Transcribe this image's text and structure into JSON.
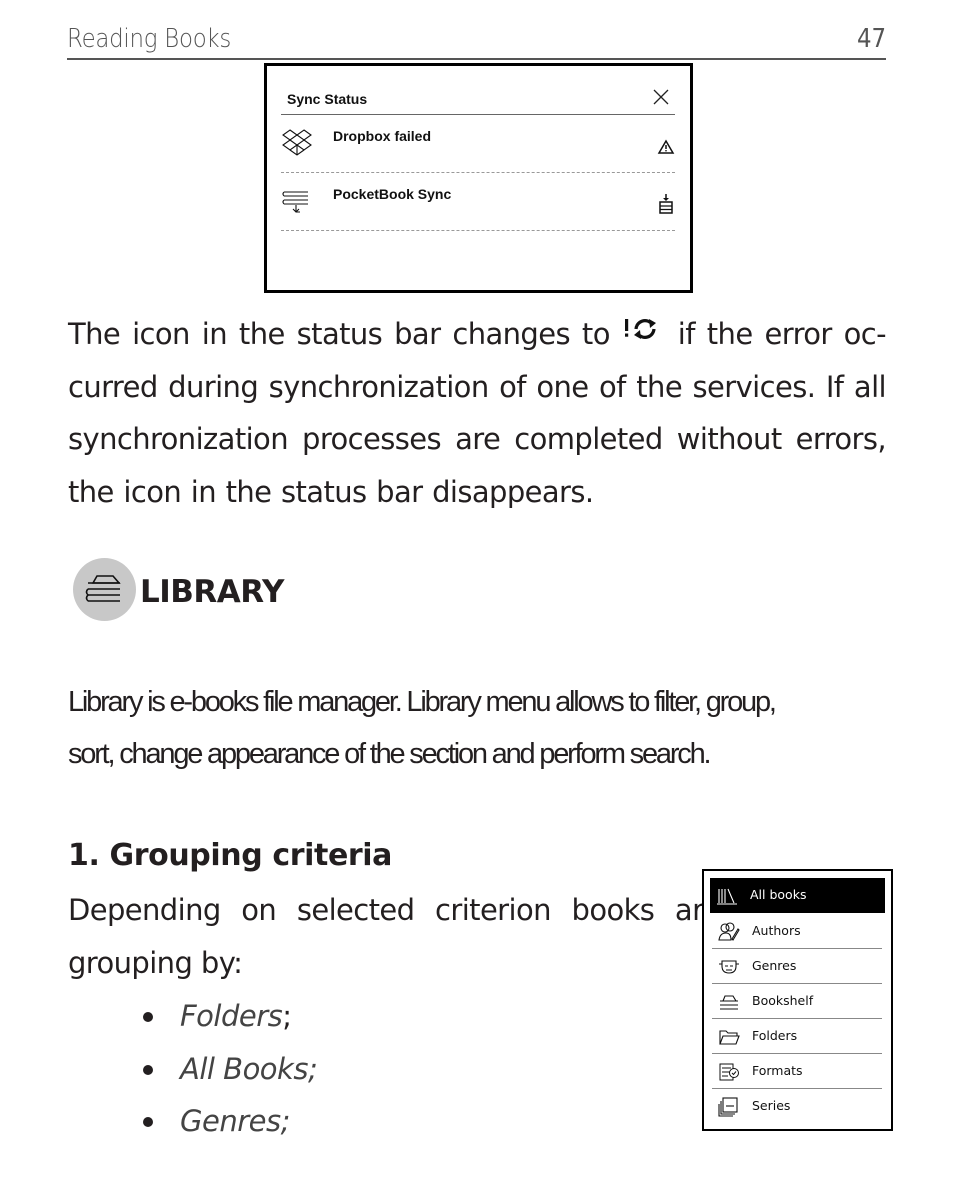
{
  "header": {
    "section_title": "Reading Books",
    "page_number": "47"
  },
  "sync_dialog": {
    "title": "Sync Status",
    "close_icon": "close-icon",
    "rows": [
      {
        "label": "Dropbox failed",
        "icon": "dropbox-icon",
        "status_icon": "warning-icon"
      },
      {
        "label": "PocketBook Sync",
        "icon": "pocketbook-sync-icon",
        "status_icon": "download-tray-icon"
      }
    ]
  },
  "paragraph_sync": {
    "lines": [
      {
        "before": "The icon in the status bar changes to",
        "icon": "sync-error-icon",
        "after": "if the error oc-"
      },
      {
        "text": "curred during synchronization of one of the services. If all"
      },
      {
        "text": "synchronization processes are completed without errors,"
      },
      {
        "text": "the icon in the status bar disappears."
      }
    ]
  },
  "library_section": {
    "icon": "library-icon",
    "title": "LIBRARY",
    "description_lines": [
      "Library is e-books file manager. Library menu allows to filter, group,",
      "sort, change appearance of the section and perform search."
    ]
  },
  "grouping": {
    "heading": "1. Grouping criteria",
    "intro_lines": [
      "Depending on selected criterion books are",
      "grouping by:"
    ],
    "bullets": [
      {
        "text": "Folders",
        "suffix": ";"
      },
      {
        "text": "All Books;",
        "suffix": ""
      },
      {
        "text": "Genres;",
        "suffix": ""
      }
    ]
  },
  "library_menu": {
    "items": [
      {
        "label": "All books",
        "icon": "all-books-icon",
        "selected": true
      },
      {
        "label": "Authors",
        "icon": "authors-icon",
        "selected": false
      },
      {
        "label": "Genres",
        "icon": "genres-icon",
        "selected": false
      },
      {
        "label": "Bookshelf",
        "icon": "bookshelf-icon",
        "selected": false
      },
      {
        "label": "Folders",
        "icon": "folder-icon",
        "selected": false
      },
      {
        "label": "Formats",
        "icon": "formats-icon",
        "selected": false
      },
      {
        "label": "Series",
        "icon": "series-icon",
        "selected": false
      }
    ]
  }
}
